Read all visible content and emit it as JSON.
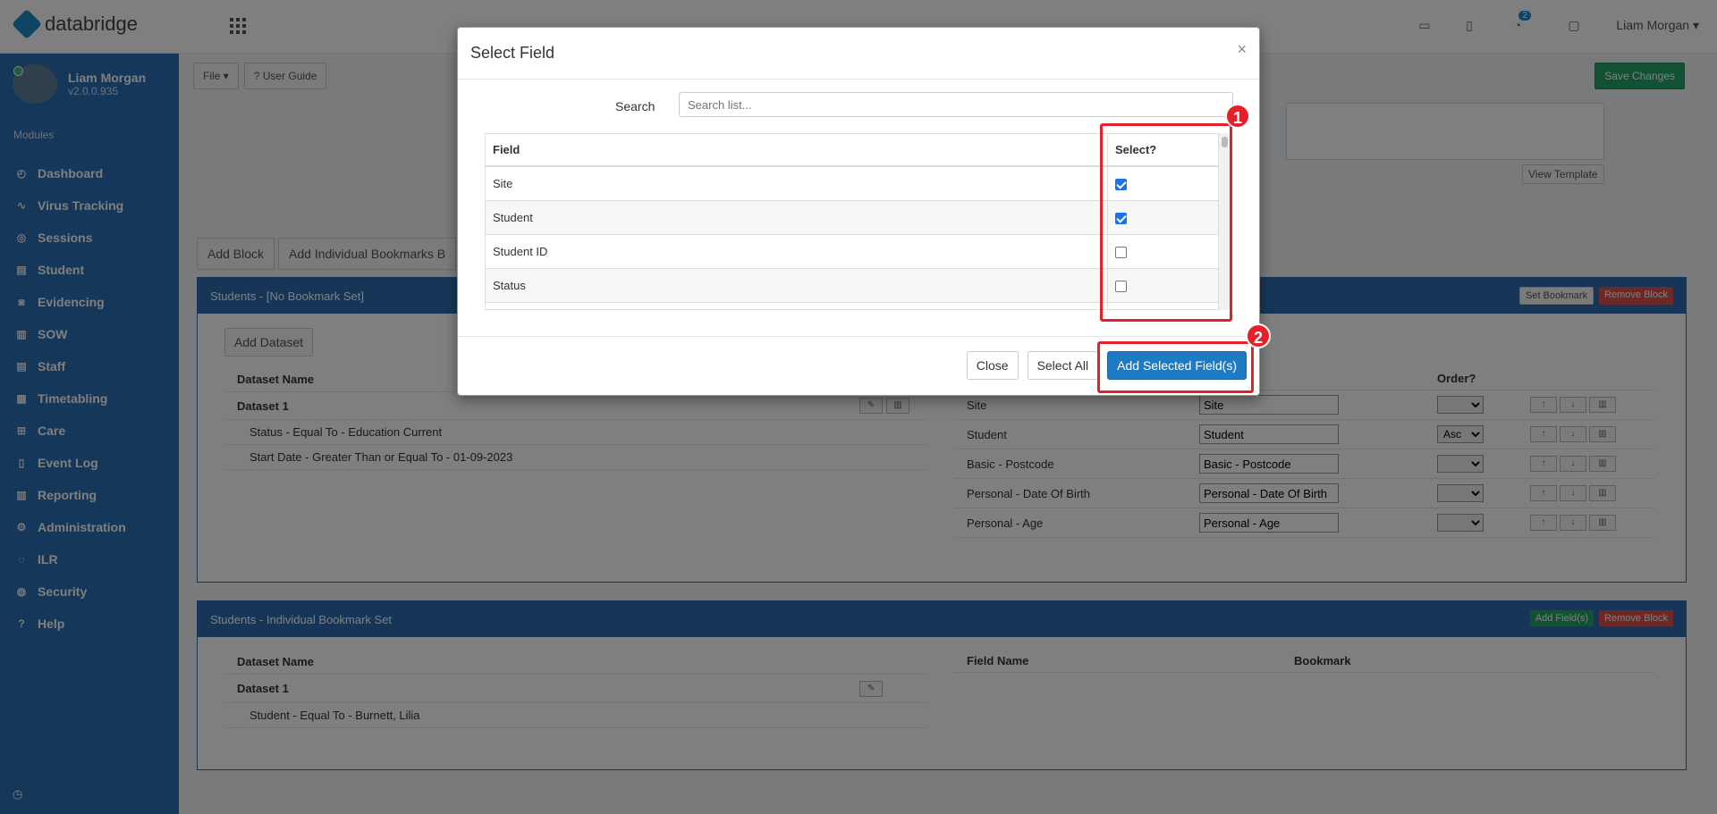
{
  "app": {
    "brand": "databridge",
    "user_menu": "Liam Morgan ▾",
    "notif_count": "2"
  },
  "sidebar": {
    "user_name": "Liam Morgan",
    "version": "v2.0.0.935",
    "modules_label": "Modules",
    "items": [
      {
        "label": "Dashboard",
        "icon": "dashboard-icon"
      },
      {
        "label": "Virus Tracking",
        "icon": "pulse-icon"
      },
      {
        "label": "Sessions",
        "icon": "sessions-icon"
      },
      {
        "label": "Student",
        "icon": "student-icon"
      },
      {
        "label": "Evidencing",
        "icon": "camera-icon"
      },
      {
        "label": "SOW",
        "icon": "book-icon"
      },
      {
        "label": "Staff",
        "icon": "staff-icon"
      },
      {
        "label": "Timetabling",
        "icon": "calendar-icon"
      },
      {
        "label": "Care",
        "icon": "care-icon"
      },
      {
        "label": "Event Log",
        "icon": "log-icon"
      },
      {
        "label": "Reporting",
        "icon": "chart-icon"
      },
      {
        "label": "Administration",
        "icon": "gear-icon"
      },
      {
        "label": "ILR",
        "icon": "ilr-icon"
      },
      {
        "label": "Security",
        "icon": "globe-icon"
      },
      {
        "label": "Help",
        "icon": "help-icon"
      }
    ]
  },
  "toolbar": {
    "file": "File ▾",
    "guide": "? User Guide",
    "save": "Save Changes",
    "view_template": "View Template"
  },
  "block_tabs": [
    "Add Block",
    "Add Individual Bookmarks B"
  ],
  "block1": {
    "title": "Students - [No Bookmark Set]",
    "set_bookmark": "Set Bookmark",
    "remove_block": "Remove Block",
    "add_dataset": "Add Dataset",
    "ds_header": "Dataset Name",
    "dataset": "Dataset 1",
    "filters": [
      "Status - Equal To - Education Current",
      "Start Date - Greater Than or Equal To - 01-09-2023"
    ],
    "order_header": "Order?",
    "fields": [
      {
        "name": "Site",
        "value": "Site",
        "order": ""
      },
      {
        "name": "Student",
        "value": "Student",
        "order": "Asc"
      },
      {
        "name": "Basic - Postcode",
        "value": "Basic - Postcode",
        "order": ""
      },
      {
        "name": "Personal - Date Of Birth",
        "value": "Personal - Date Of Birth",
        "order": ""
      },
      {
        "name": "Personal - Age",
        "value": "Personal - Age",
        "order": ""
      }
    ]
  },
  "block2": {
    "title": "Students - Individual Bookmark Set",
    "add_fields": "Add Field(s)",
    "remove_block": "Remove Block",
    "ds_header": "Dataset Name",
    "dataset": "Dataset 1",
    "filter": "Student - Equal To - Burnett, Lilia",
    "field_header": "Field Name",
    "bookmark_header": "Bookmark"
  },
  "modal": {
    "title": "Select Field",
    "close_x": "×",
    "search_label": "Search",
    "search_placeholder": "Search list...",
    "col_field": "Field",
    "col_select": "Select?",
    "rows": [
      {
        "field": "Site",
        "checked": true
      },
      {
        "field": "Student",
        "checked": true
      },
      {
        "field": "Student ID",
        "checked": false
      },
      {
        "field": "Status",
        "checked": false
      }
    ],
    "btn_close": "Close",
    "btn_select_all": "Select All",
    "btn_add": "Add Selected Field(s)"
  },
  "annotations": [
    "1",
    "2"
  ]
}
